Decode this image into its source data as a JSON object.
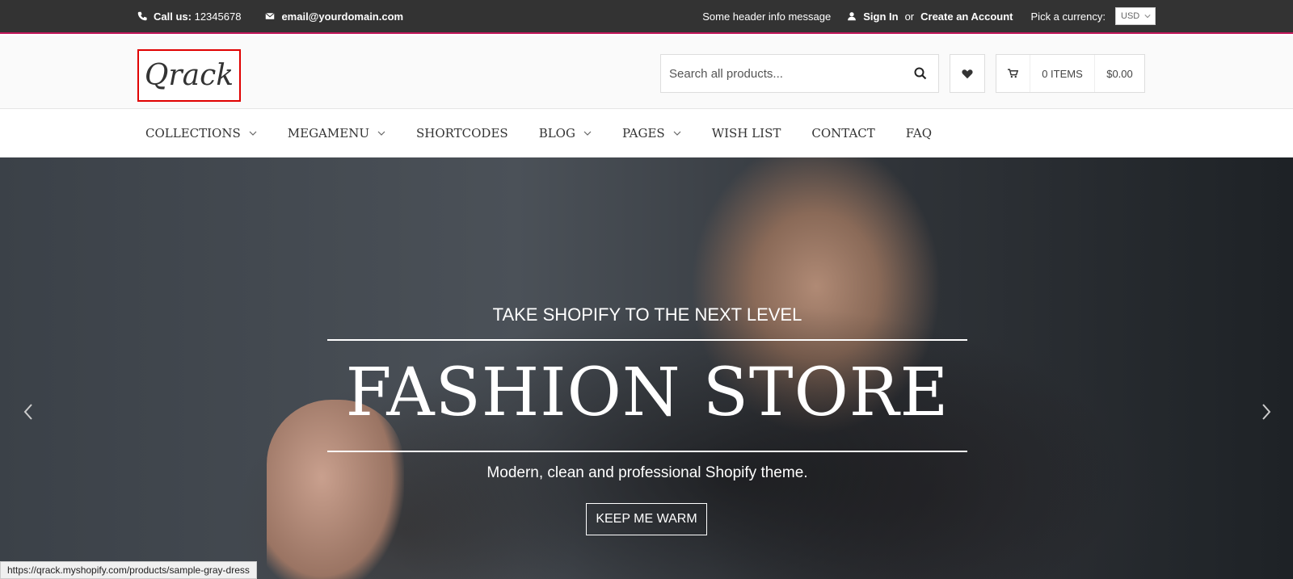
{
  "topbar": {
    "phone_label": "Call us:",
    "phone_number": "12345678",
    "email": "email@yourdomain.com",
    "header_message": "Some header info message",
    "sign_in": "Sign In",
    "or": "or",
    "create_account": "Create an Account",
    "currency_label": "Pick a currency:",
    "currency_value": "USD"
  },
  "header": {
    "logo_text": "Qrack",
    "search_placeholder": "Search all products...",
    "cart_items": "0 ITEMS",
    "cart_total": "$0.00"
  },
  "nav": {
    "items": [
      {
        "label": "COLLECTIONS",
        "has_dropdown": true
      },
      {
        "label": "MEGAMENU",
        "has_dropdown": true
      },
      {
        "label": "SHORTCODES",
        "has_dropdown": false
      },
      {
        "label": "BLOG",
        "has_dropdown": true
      },
      {
        "label": "PAGES",
        "has_dropdown": true
      },
      {
        "label": "WISH LIST",
        "has_dropdown": false
      },
      {
        "label": "CONTACT",
        "has_dropdown": false
      },
      {
        "label": "FAQ",
        "has_dropdown": false
      }
    ]
  },
  "hero": {
    "tagline": "TAKE SHOPIFY TO THE NEXT LEVEL",
    "headline": "FASHION STORE",
    "subtitle": "Modern, clean and professional Shopify theme.",
    "cta": "KEEP ME WARM"
  },
  "status_bar": {
    "url": "https://qrack.myshopify.com/products/sample-gray-dress"
  },
  "colors": {
    "topbar_bg": "#333333",
    "accent_line": "#c2185b",
    "logo_border": "#e00000"
  }
}
